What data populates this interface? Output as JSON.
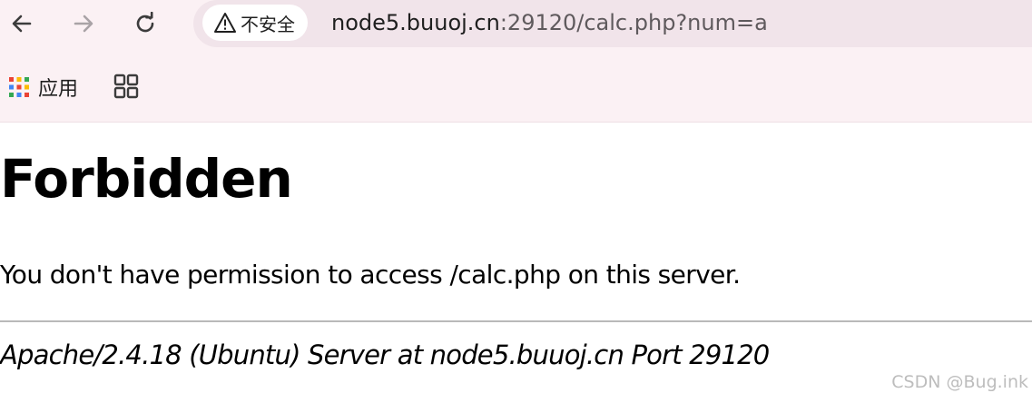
{
  "browser": {
    "nav": {
      "back_icon": "arrow-left-icon",
      "forward_icon": "arrow-right-icon",
      "reload_icon": "reload-icon"
    },
    "omnibox": {
      "security_label": "不安全",
      "security_icon": "warning-triangle-icon",
      "url_host": "node5.buuoj.cn",
      "url_rest": ":29120/calc.php?num=a"
    },
    "bookmarks": {
      "apps_label": "应用",
      "apps_icon": "apps-grid-icon",
      "tab_groups_icon": "tab-groups-icon"
    },
    "colors": {
      "chrome_bg": "#fbf1f4",
      "omnibox_bg": "#f1e4ea"
    }
  },
  "page": {
    "title": "Forbidden",
    "message": "You don't have permission to access /calc.php on this server.",
    "address": "Apache/2.4.18 (Ubuntu) Server at node5.buuoj.cn Port 29120"
  },
  "watermark": {
    "text": "CSDN @Bug.ink"
  }
}
